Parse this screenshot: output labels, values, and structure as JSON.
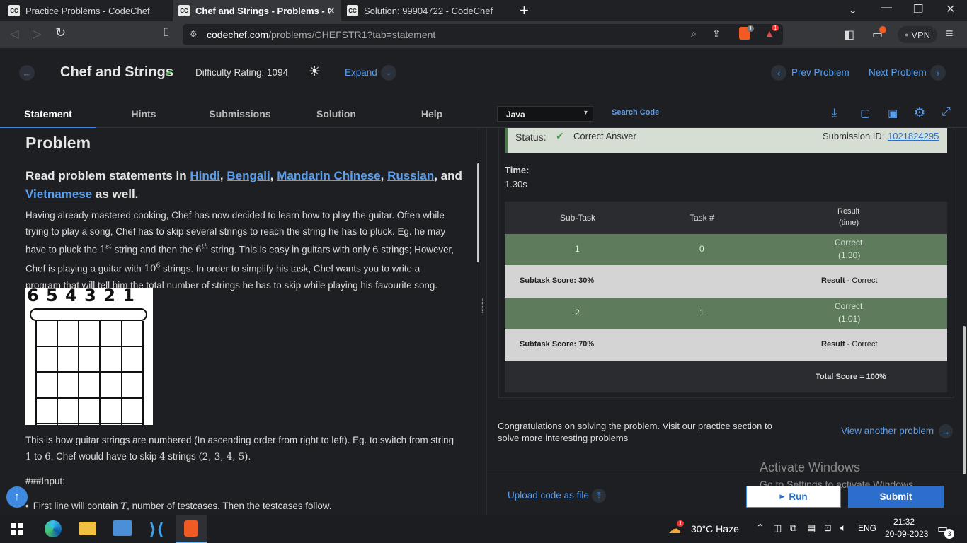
{
  "browser": {
    "tabs": [
      {
        "label": "Practice Problems - CodeChef",
        "favicon": "CC"
      },
      {
        "label": "Chef and Strings - Problems - Co",
        "favicon": "CC"
      },
      {
        "label": "Solution: 99904722 - CodeChef",
        "favicon": "CC"
      }
    ],
    "url_host": "codechef.com",
    "url_path": "/problems/CHEFSTR1?tab=statement",
    "vpn_label": "VPN",
    "brave_badge": "1",
    "alert_badge": "1"
  },
  "header": {
    "title": "Chef and Strings",
    "difficulty": "Difficulty Rating: 1094",
    "expand": "Expand",
    "prev": "Prev Problem",
    "next": "Next Problem"
  },
  "problem_tabs": [
    "Statement",
    "Hints",
    "Submissions",
    "Solution",
    "Help"
  ],
  "editor": {
    "language": "Java",
    "search_code": "Search Code"
  },
  "statement": {
    "heading": "Problem",
    "read_prefix": "Read problem statements in ",
    "languages": [
      "Hindi",
      "Bengali",
      "Mandarin Chinese",
      "Russian"
    ],
    "and": ", and ",
    "vietnamese": "Vietnamese",
    "as_well": " as well.",
    "para1_a": "Having already mastered cooking, Chef has now decided to learn how to play the guitar. Often while trying to play a song, Chef has to skip several strings to reach the string he has to pluck. Eg. he may have to pluck the ",
    "para1_b": " string and then the ",
    "para1_c": " string. This is easy in guitars with only ",
    "para1_d": " strings; However, Chef is playing a guitar with ",
    "para1_e": " strings. In order to simplify his task, Chef wants you to write a program that will tell him the total number of strings he has to skip while playing his favourite song.",
    "guitar_numbers": "6 5 4 3 2 1",
    "para2_a": "This is how guitar strings are numbered (In ascending order from right to left). Eg. to switch from string ",
    "para2_b": " to ",
    "para2_c": ", Chef would have to skip ",
    "para2_d": " strings ",
    "para2_e": ".",
    "input_heading": "###Input:",
    "bullet1_a": "First line will contain ",
    "bullet1_b": ", number of testcases. Then the testcases follow."
  },
  "result": {
    "status_label": "Status:",
    "status_value": "Correct Answer",
    "submission_label": "Submission ID:",
    "submission_id": "1021824295",
    "time_label": "Time:",
    "time_value": "1.30s",
    "headers": [
      "Sub-Task",
      "Task #",
      "Result",
      "(time)"
    ],
    "rows": [
      {
        "subtask": "1",
        "task": "0",
        "result": "Correct",
        "time": "(1.30)"
      },
      {
        "subtask": "2",
        "task": "1",
        "result": "Correct",
        "time": "(1.01)"
      }
    ],
    "scores": [
      {
        "label": "Subtask Score: 30%",
        "result_label": "Result",
        "result_value": " - Correct"
      },
      {
        "label": "Subtask Score: 70%",
        "result_label": "Result",
        "result_value": " - Correct"
      }
    ],
    "total": "Total Score = 100%",
    "congrats": "Congratulations on solving the problem. Visit our practice section to solve more interesting problems",
    "view_another": "View another problem",
    "upload": "Upload code as file",
    "run": "Run",
    "submit": "Submit",
    "watermark_title": "Activate Windows",
    "watermark_sub": "Go to Settings to activate Windows."
  },
  "taskbar": {
    "weather": "30°C  Haze",
    "lang": "ENG",
    "time": "21:32",
    "date": "20-09-2023",
    "weather_badge": "1",
    "notif_count": "3"
  },
  "colors": {
    "accent": "#3f8ae0",
    "correct_row": "#5e7b5c",
    "score_row": "#d4d4d4",
    "submit": "#2c6ecb"
  }
}
